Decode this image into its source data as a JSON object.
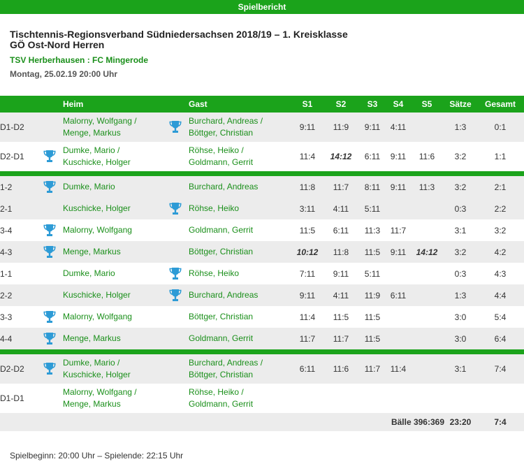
{
  "header": {
    "title": "Spielbericht"
  },
  "match": {
    "title_line1": "Tischtennis-Regionsverband Südniedersachsen 2018/19 – 1. Kreisklasse",
    "title_line2": "GÖ Ost-Nord Herren",
    "teams": "TSV Herberhausen : FC Mingerode",
    "datetime": "Montag, 25.02.19 20:00 Uhr"
  },
  "columns": {
    "heim": "Heim",
    "gast": "Gast",
    "s1": "S1",
    "s2": "S2",
    "s3": "S3",
    "s4": "S4",
    "s5": "S5",
    "saetze": "Sätze",
    "gesamt": "Gesamt"
  },
  "rows": [
    {
      "pair": "D1-D2",
      "heim": [
        "Malorny, Wolfgang /",
        "Menge, Markus"
      ],
      "gast": [
        "Burchard, Andreas /",
        "Böttger, Christian"
      ],
      "winner": "gast",
      "sets": [
        "9:11",
        "11:9",
        "9:11",
        "4:11",
        ""
      ],
      "saetze": "1:3",
      "gesamt": "0:1"
    },
    {
      "pair": "D2-D1",
      "heim": [
        "Dumke, Mario /",
        "Kuschicke, Holger"
      ],
      "gast": [
        "Röhse, Heiko /",
        "Goldmann, Gerrit"
      ],
      "winner": "heim",
      "sets": [
        "11:4",
        "14:12",
        "6:11",
        "9:11",
        "11:6"
      ],
      "saetze": "3:2",
      "gesamt": "1:1"
    },
    {
      "pair": "1-2",
      "heim": [
        "Dumke, Mario"
      ],
      "gast": [
        "Burchard, Andreas"
      ],
      "winner": "heim",
      "sets": [
        "11:8",
        "11:7",
        "8:11",
        "9:11",
        "11:3"
      ],
      "saetze": "3:2",
      "gesamt": "2:1"
    },
    {
      "pair": "2-1",
      "heim": [
        "Kuschicke, Holger"
      ],
      "gast": [
        "Röhse, Heiko"
      ],
      "winner": "gast",
      "sets": [
        "3:11",
        "4:11",
        "5:11",
        "",
        ""
      ],
      "saetze": "0:3",
      "gesamt": "2:2"
    },
    {
      "pair": "3-4",
      "heim": [
        "Malorny, Wolfgang"
      ],
      "gast": [
        "Goldmann, Gerrit"
      ],
      "winner": "heim",
      "sets": [
        "11:5",
        "6:11",
        "11:3",
        "11:7",
        ""
      ],
      "saetze": "3:1",
      "gesamt": "3:2"
    },
    {
      "pair": "4-3",
      "heim": [
        "Menge, Markus"
      ],
      "gast": [
        "Böttger, Christian"
      ],
      "winner": "heim",
      "sets": [
        "10:12",
        "11:8",
        "11:5",
        "9:11",
        "14:12"
      ],
      "saetze": "3:2",
      "gesamt": "4:2"
    },
    {
      "pair": "1-1",
      "heim": [
        "Dumke, Mario"
      ],
      "gast": [
        "Röhse, Heiko"
      ],
      "winner": "gast",
      "sets": [
        "7:11",
        "9:11",
        "5:11",
        "",
        ""
      ],
      "saetze": "0:3",
      "gesamt": "4:3"
    },
    {
      "pair": "2-2",
      "heim": [
        "Kuschicke, Holger"
      ],
      "gast": [
        "Burchard, Andreas"
      ],
      "winner": "gast",
      "sets": [
        "9:11",
        "4:11",
        "11:9",
        "6:11",
        ""
      ],
      "saetze": "1:3",
      "gesamt": "4:4"
    },
    {
      "pair": "3-3",
      "heim": [
        "Malorny, Wolfgang"
      ],
      "gast": [
        "Böttger, Christian"
      ],
      "winner": "heim",
      "sets": [
        "11:4",
        "11:5",
        "11:5",
        "",
        ""
      ],
      "saetze": "3:0",
      "gesamt": "5:4"
    },
    {
      "pair": "4-4",
      "heim": [
        "Menge, Markus"
      ],
      "gast": [
        "Goldmann, Gerrit"
      ],
      "winner": "heim",
      "sets": [
        "11:7",
        "11:7",
        "11:5",
        "",
        ""
      ],
      "saetze": "3:0",
      "gesamt": "6:4"
    },
    {
      "pair": "D2-D2",
      "heim": [
        "Dumke, Mario /",
        "Kuschicke, Holger"
      ],
      "gast": [
        "Burchard, Andreas /",
        "Böttger, Christian"
      ],
      "winner": "heim",
      "sets": [
        "6:11",
        "11:6",
        "11:7",
        "11:4",
        ""
      ],
      "saetze": "3:1",
      "gesamt": "7:4"
    },
    {
      "pair": "D1-D1",
      "heim": [
        "Malorny, Wolfgang /",
        "Menge, Markus"
      ],
      "gast": [
        "Röhse, Heiko /",
        "Goldmann, Gerrit"
      ],
      "winner": "",
      "sets": [
        "",
        "",
        "",
        "",
        ""
      ],
      "saetze": "",
      "gesamt": ""
    }
  ],
  "totals": {
    "balls": "Bälle 396:369",
    "saetze": "23:20",
    "gesamt": "7:4"
  },
  "footer": {
    "text": "Spielbeginn: 20:00 Uhr – Spielende: 22:15 Uhr"
  },
  "icons": {
    "winner": "trophy-icon"
  },
  "colors": {
    "accent": "#1ba31b",
    "player": "#1a8f1a",
    "trophy": "#2d9bd6",
    "row_alt": "#ececec"
  }
}
